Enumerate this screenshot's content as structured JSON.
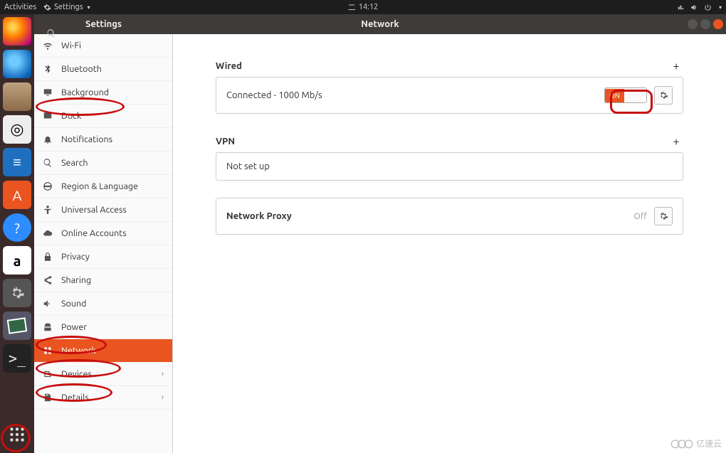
{
  "topbar": {
    "activities": "Activities",
    "app_menu": "Settings",
    "clock_prefix": "二",
    "clock": "14:12"
  },
  "launcher": {
    "apps": [
      {
        "name": "firefox"
      },
      {
        "name": "thunderbird"
      },
      {
        "name": "files"
      },
      {
        "name": "rhythmbox"
      },
      {
        "name": "libreoffice-writer"
      },
      {
        "name": "ubuntu-software"
      },
      {
        "name": "help"
      },
      {
        "name": "amazon"
      },
      {
        "name": "settings"
      },
      {
        "name": "shotwell"
      },
      {
        "name": "terminal"
      },
      {
        "name": "show-apps"
      }
    ]
  },
  "window": {
    "sidebar_title": "Settings",
    "title": "Network"
  },
  "sidebar": {
    "items": [
      {
        "id": "wifi",
        "label": "Wi-Fi",
        "icon": "wifi"
      },
      {
        "id": "bluetooth",
        "label": "Bluetooth",
        "icon": "bluetooth"
      },
      {
        "id": "background",
        "label": "Background",
        "icon": "display"
      },
      {
        "id": "dock",
        "label": "Dock",
        "icon": "dock"
      },
      {
        "id": "notifications",
        "label": "Notifications",
        "icon": "bell"
      },
      {
        "id": "search",
        "label": "Search",
        "icon": "search"
      },
      {
        "id": "region",
        "label": "Region & Language",
        "icon": "globe"
      },
      {
        "id": "access",
        "label": "Universal Access",
        "icon": "access"
      },
      {
        "id": "online",
        "label": "Online Accounts",
        "icon": "cloud"
      },
      {
        "id": "privacy",
        "label": "Privacy",
        "icon": "lock"
      },
      {
        "id": "sharing",
        "label": "Sharing",
        "icon": "share"
      },
      {
        "id": "sound",
        "label": "Sound",
        "icon": "sound"
      },
      {
        "id": "power",
        "label": "Power",
        "icon": "power"
      },
      {
        "id": "network",
        "label": "Network",
        "icon": "network",
        "active": true
      },
      {
        "id": "devices",
        "label": "Devices",
        "icon": "devices",
        "chevron": true
      },
      {
        "id": "details",
        "label": "Details",
        "icon": "details",
        "chevron": true
      }
    ]
  },
  "content": {
    "wired_heading": "Wired",
    "wired_status": "Connected - 1000 Mb/s",
    "switch_on_label": "ON",
    "vpn_heading": "VPN",
    "vpn_status": "Not set up",
    "proxy_heading": "Network Proxy",
    "proxy_status": "Off"
  },
  "watermark": "亿速云",
  "annotations": [
    {
      "target": "sidebar-background"
    },
    {
      "target": "sidebar-power"
    },
    {
      "target": "sidebar-network"
    },
    {
      "target": "sidebar-devices"
    },
    {
      "target": "wired-gear"
    },
    {
      "target": "show-apps"
    }
  ]
}
